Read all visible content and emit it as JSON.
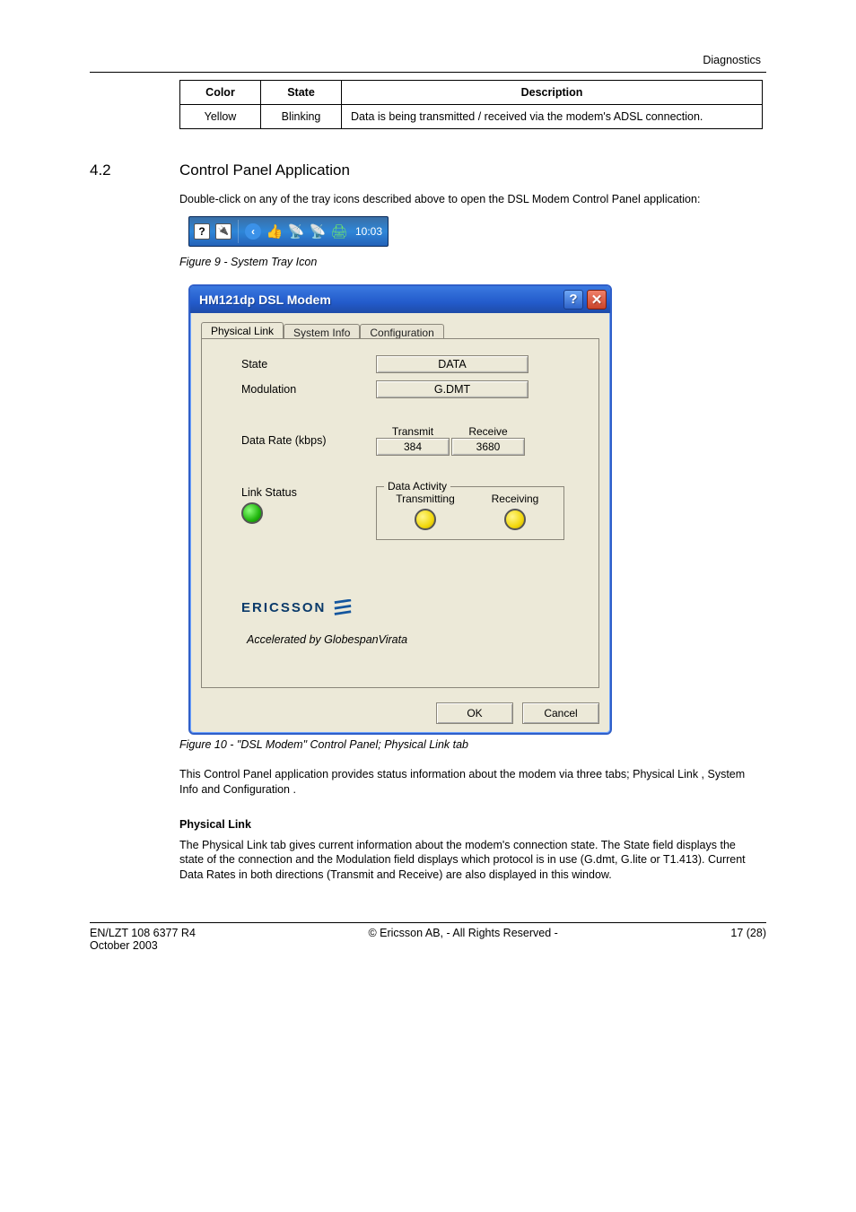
{
  "header": {
    "right_text": "Diagnostics"
  },
  "table": {
    "headers": [
      "Color",
      "State",
      "Description"
    ],
    "row": {
      "color": "Yellow",
      "state": "Blinking",
      "desc": "Data is being transmitted / received via the modem's ADSL connection."
    }
  },
  "section": {
    "num": "4.2",
    "title": "Control Panel Application"
  },
  "intro": "Double-click on any of the tray icons described above to open the DSL Modem Control Panel application:",
  "tray": {
    "time": "10:03"
  },
  "fig9": {
    "caption": "Figure 9 - System Tray Icon"
  },
  "dialog": {
    "title": "HM121dp DSL Modem",
    "tabs": [
      "Physical Link",
      "System Info",
      "Configuration"
    ],
    "labels": {
      "state": "State",
      "modulation": "Modulation",
      "datarate": "Data Rate (kbps)",
      "linkstatus": "Link Status",
      "dataactivity": "Data Activity",
      "transmit": "Transmit",
      "receive": "Receive",
      "transmitting": "Transmitting",
      "receiving": "Receiving"
    },
    "values": {
      "state": "DATA",
      "modulation": "G.DMT",
      "tx": "384",
      "rx": "3680"
    },
    "brand": "ERICSSON",
    "accel": "Accelerated by GlobespanVirata",
    "buttons": {
      "ok": "OK",
      "cancel": "Cancel"
    }
  },
  "fig10": {
    "caption": "Figure 10 - \"DSL Modem\" Control Panel; Physical Link tab"
  },
  "after_text": "This Control Panel application provides status information about the modem via three tabs;  Physical Link ,  System Info  and  Configuration .",
  "physlink_heading": "Physical Link",
  "physlink_body": "The Physical Link tab gives current information about the modem's connection state. The  State  field displays the state of the connection and the  Modulation  field displays which protocol is in use (G.dmt, G.lite or T1.413). Current  Data Rates  in both directions (Transmit and Receive) are also displayed in this window.",
  "footer": {
    "left": "EN/LZT 108 6377 R4",
    "center": "© Ericsson AB, - All Rights Reserved -",
    "right": "17 (28)",
    "date": "October 2003"
  }
}
